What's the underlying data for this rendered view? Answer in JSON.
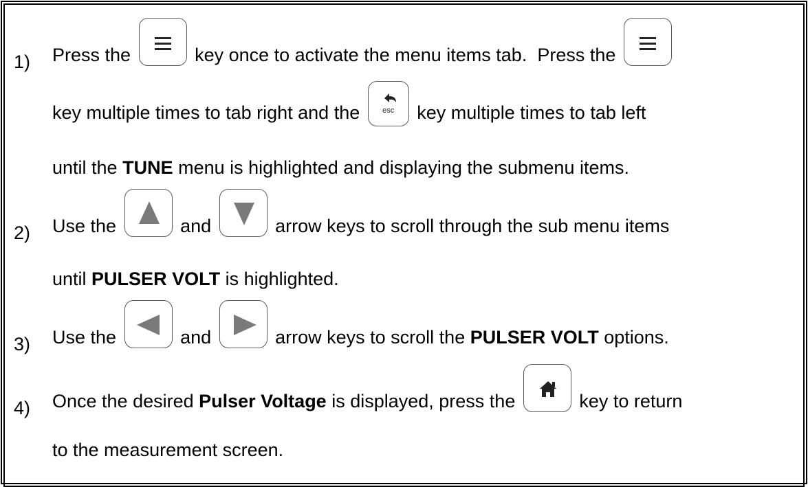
{
  "steps": [
    {
      "number": "1)",
      "line1": {
        "a": "Press the ",
        "b": " key once to activate the menu items tab.  Press the "
      },
      "line2": {
        "a": "key multiple times to tab right and the ",
        "b": " key multiple times to tab left"
      },
      "line3": {
        "a": "until the ",
        "b": "TUNE",
        "c": " menu is highlighted and displaying the submenu items."
      }
    },
    {
      "number": "2)",
      "line1": {
        "a": "Use the ",
        "b": " and ",
        "c": " arrow keys to scroll through the sub menu items"
      },
      "line2": {
        "a": "until ",
        "b": "PULSER VOLT",
        "c": " is highlighted."
      }
    },
    {
      "number": "3)",
      "line1": {
        "a": "Use the ",
        "b": " and ",
        "c": " arrow keys to scroll the ",
        "d": "PULSER VOLT",
        "e": " options."
      }
    },
    {
      "number": "4)",
      "line1": {
        "a": "Once the desired ",
        "b": "Pulser Voltage",
        "c": " is displayed, press the ",
        "d": " key to return"
      },
      "line2": {
        "a": "to the measurement screen."
      }
    }
  ],
  "keys": {
    "menu": "menu-icon",
    "esc": "back-arrow-icon",
    "esc_label": "esc",
    "up": "up-arrow-icon",
    "down": "down-arrow-icon",
    "left": "left-arrow-icon",
    "right": "right-arrow-icon",
    "home": "home-icon"
  }
}
